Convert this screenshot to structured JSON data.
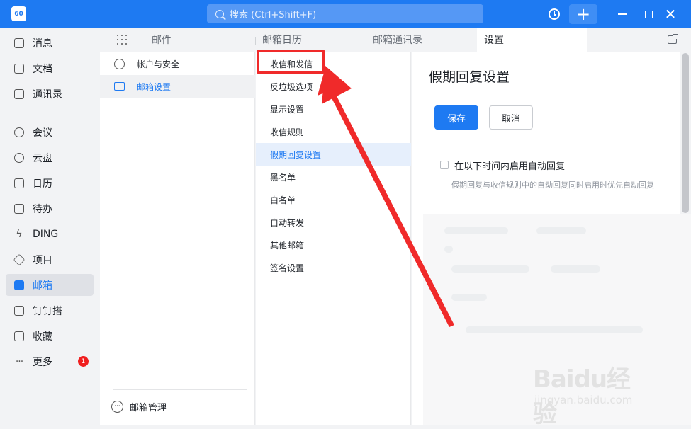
{
  "titlebar": {
    "logo_text": "60",
    "search_placeholder": "搜索 (Ctrl+Shift+F)",
    "plus_label": "+",
    "close_label": "✕"
  },
  "nav": {
    "items": [
      {
        "label": "消息",
        "icon": "message-icon"
      },
      {
        "label": "文档",
        "icon": "document-icon"
      },
      {
        "label": "通讯录",
        "icon": "contacts-icon"
      },
      {
        "label": "会议",
        "icon": "meeting-icon"
      },
      {
        "label": "云盘",
        "icon": "cloud-icon"
      },
      {
        "label": "日历",
        "icon": "calendar-icon"
      },
      {
        "label": "待办",
        "icon": "todo-icon"
      },
      {
        "label": "DING",
        "icon": "bolt-icon"
      },
      {
        "label": "项目",
        "icon": "project-icon"
      },
      {
        "label": "邮箱",
        "icon": "mail-icon",
        "active": true
      },
      {
        "label": "钉钉搭",
        "icon": "builder-icon"
      },
      {
        "label": "收藏",
        "icon": "favorites-icon"
      },
      {
        "label": "更多",
        "icon": "more-icon",
        "badge": "1"
      }
    ]
  },
  "tabs": [
    {
      "label": "邮件"
    },
    {
      "label": "邮箱日历"
    },
    {
      "label": "邮箱通讯录"
    },
    {
      "label": "设置",
      "active": true
    }
  ],
  "settings_menu": {
    "items": [
      {
        "label": "帐户与安全",
        "icon": "user-icon"
      },
      {
        "label": "邮箱设置",
        "icon": "mail-icon",
        "active": true
      }
    ],
    "bottom_label": "邮箱管理"
  },
  "submenu": {
    "items": [
      {
        "label": "收信和发信"
      },
      {
        "label": "反垃圾选项"
      },
      {
        "label": "显示设置"
      },
      {
        "label": "收信规则"
      },
      {
        "label": "假期回复设置",
        "active": true
      },
      {
        "label": "黑名单"
      },
      {
        "label": "白名单"
      },
      {
        "label": "自动转发"
      },
      {
        "label": "其他邮箱"
      },
      {
        "label": "签名设置"
      }
    ]
  },
  "main": {
    "title": "假期回复设置",
    "save_label": "保存",
    "cancel_label": "取消",
    "checkbox_label": "在以下时间内启用自动回复",
    "checkbox_checked": false,
    "description": "假期回复与收信规则中的自动回复同时启用时优先自动回复"
  },
  "colors": {
    "accent": "#1e7af2",
    "annotation": "#f02a2a"
  },
  "watermark": {
    "main": "Baidu经验",
    "sub": "jingyan.baidu.com"
  }
}
